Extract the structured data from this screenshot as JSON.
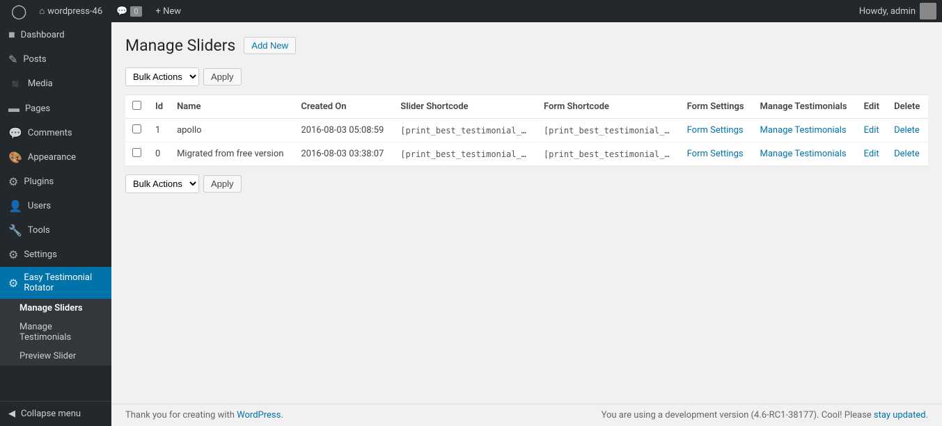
{
  "adminbar": {
    "logo": "W",
    "site_name": "wordpress-46",
    "comments_label": "Comments",
    "comment_count": "0",
    "new_label": "+ New",
    "howdy": "Howdy, admin"
  },
  "sidebar": {
    "items": [
      {
        "id": "dashboard",
        "label": "Dashboard",
        "icon": "⊞"
      },
      {
        "id": "posts",
        "label": "Posts",
        "icon": "✎"
      },
      {
        "id": "media",
        "label": "Media",
        "icon": "⬛"
      },
      {
        "id": "pages",
        "label": "Pages",
        "icon": "▤"
      },
      {
        "id": "comments",
        "label": "Comments",
        "icon": "💬"
      },
      {
        "id": "appearance",
        "label": "Appearance",
        "icon": "🎨"
      },
      {
        "id": "plugins",
        "label": "Plugins",
        "icon": "⚙"
      },
      {
        "id": "users",
        "label": "Users",
        "icon": "👤"
      },
      {
        "id": "tools",
        "label": "Tools",
        "icon": "🔧"
      },
      {
        "id": "settings",
        "label": "Settings",
        "icon": "⚙"
      }
    ],
    "plugin_item": {
      "id": "easy-testimonial-rotator",
      "label": "Easy Testimonial Rotator",
      "icon": "⚙"
    },
    "submenu": [
      {
        "id": "manage-sliders",
        "label": "Manage Sliders",
        "active": true
      },
      {
        "id": "manage-testimonials",
        "label": "Manage Testimonials",
        "active": false
      },
      {
        "id": "preview-slider",
        "label": "Preview Slider",
        "active": false
      }
    ],
    "collapse_label": "Collapse menu"
  },
  "main": {
    "page_title": "Manage Sliders",
    "add_new_label": "Add New",
    "bulk_actions_label": "Bulk Actions",
    "apply_label": "Apply",
    "table": {
      "columns": [
        "",
        "Id",
        "Name",
        "Created On",
        "Slider Shortcode",
        "Form Shortcode",
        "Form Settings",
        "Manage Testimonials",
        "Edit",
        "Delete"
      ],
      "rows": [
        {
          "id": "1",
          "name": "apollo",
          "created_on": "2016-08-03 05:08:59",
          "slider_shortcode": "[print_best_testimonial_slider i",
          "form_shortcode": "[print_best_testimonial_form ic",
          "form_settings_link": "Form Settings",
          "manage_testimonials_link": "Manage Testimonials",
          "edit_link": "Edit",
          "delete_link": "Delete"
        },
        {
          "id": "0",
          "name": "Migrated from free version",
          "created_on": "2016-08-03 03:38:07",
          "slider_shortcode": "[print_best_testimonial_slider i",
          "form_shortcode": "[print_best_testimonial_form ic",
          "form_settings_link": "Form Settings",
          "manage_testimonials_link": "Manage Testimonials",
          "edit_link": "Edit",
          "delete_link": "Delete"
        }
      ]
    }
  },
  "footer": {
    "thank_you_text": "Thank you for creating with",
    "wordpress_link": "WordPress.",
    "dev_version_text": "You are using a development version (4.6-RC1-38177). Cool! Please",
    "stay_updated_link": "stay updated."
  }
}
